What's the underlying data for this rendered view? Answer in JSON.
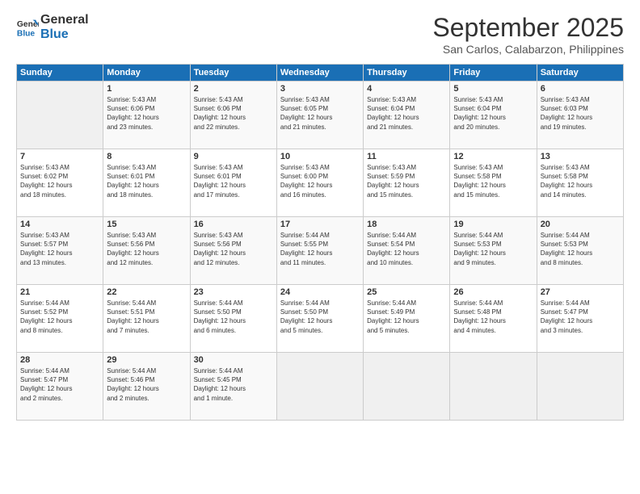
{
  "header": {
    "logo_line1": "General",
    "logo_line2": "Blue",
    "month": "September 2025",
    "location": "San Carlos, Calabarzon, Philippines"
  },
  "days_of_week": [
    "Sunday",
    "Monday",
    "Tuesday",
    "Wednesday",
    "Thursday",
    "Friday",
    "Saturday"
  ],
  "weeks": [
    [
      {
        "day": "",
        "info": ""
      },
      {
        "day": "1",
        "info": "Sunrise: 5:43 AM\nSunset: 6:06 PM\nDaylight: 12 hours\nand 23 minutes."
      },
      {
        "day": "2",
        "info": "Sunrise: 5:43 AM\nSunset: 6:06 PM\nDaylight: 12 hours\nand 22 minutes."
      },
      {
        "day": "3",
        "info": "Sunrise: 5:43 AM\nSunset: 6:05 PM\nDaylight: 12 hours\nand 21 minutes."
      },
      {
        "day": "4",
        "info": "Sunrise: 5:43 AM\nSunset: 6:04 PM\nDaylight: 12 hours\nand 21 minutes."
      },
      {
        "day": "5",
        "info": "Sunrise: 5:43 AM\nSunset: 6:04 PM\nDaylight: 12 hours\nand 20 minutes."
      },
      {
        "day": "6",
        "info": "Sunrise: 5:43 AM\nSunset: 6:03 PM\nDaylight: 12 hours\nand 19 minutes."
      }
    ],
    [
      {
        "day": "7",
        "info": "Sunrise: 5:43 AM\nSunset: 6:02 PM\nDaylight: 12 hours\nand 18 minutes."
      },
      {
        "day": "8",
        "info": "Sunrise: 5:43 AM\nSunset: 6:01 PM\nDaylight: 12 hours\nand 18 minutes."
      },
      {
        "day": "9",
        "info": "Sunrise: 5:43 AM\nSunset: 6:01 PM\nDaylight: 12 hours\nand 17 minutes."
      },
      {
        "day": "10",
        "info": "Sunrise: 5:43 AM\nSunset: 6:00 PM\nDaylight: 12 hours\nand 16 minutes."
      },
      {
        "day": "11",
        "info": "Sunrise: 5:43 AM\nSunset: 5:59 PM\nDaylight: 12 hours\nand 15 minutes."
      },
      {
        "day": "12",
        "info": "Sunrise: 5:43 AM\nSunset: 5:58 PM\nDaylight: 12 hours\nand 15 minutes."
      },
      {
        "day": "13",
        "info": "Sunrise: 5:43 AM\nSunset: 5:58 PM\nDaylight: 12 hours\nand 14 minutes."
      }
    ],
    [
      {
        "day": "14",
        "info": "Sunrise: 5:43 AM\nSunset: 5:57 PM\nDaylight: 12 hours\nand 13 minutes."
      },
      {
        "day": "15",
        "info": "Sunrise: 5:43 AM\nSunset: 5:56 PM\nDaylight: 12 hours\nand 12 minutes."
      },
      {
        "day": "16",
        "info": "Sunrise: 5:43 AM\nSunset: 5:56 PM\nDaylight: 12 hours\nand 12 minutes."
      },
      {
        "day": "17",
        "info": "Sunrise: 5:44 AM\nSunset: 5:55 PM\nDaylight: 12 hours\nand 11 minutes."
      },
      {
        "day": "18",
        "info": "Sunrise: 5:44 AM\nSunset: 5:54 PM\nDaylight: 12 hours\nand 10 minutes."
      },
      {
        "day": "19",
        "info": "Sunrise: 5:44 AM\nSunset: 5:53 PM\nDaylight: 12 hours\nand 9 minutes."
      },
      {
        "day": "20",
        "info": "Sunrise: 5:44 AM\nSunset: 5:53 PM\nDaylight: 12 hours\nand 8 minutes."
      }
    ],
    [
      {
        "day": "21",
        "info": "Sunrise: 5:44 AM\nSunset: 5:52 PM\nDaylight: 12 hours\nand 8 minutes."
      },
      {
        "day": "22",
        "info": "Sunrise: 5:44 AM\nSunset: 5:51 PM\nDaylight: 12 hours\nand 7 minutes."
      },
      {
        "day": "23",
        "info": "Sunrise: 5:44 AM\nSunset: 5:50 PM\nDaylight: 12 hours\nand 6 minutes."
      },
      {
        "day": "24",
        "info": "Sunrise: 5:44 AM\nSunset: 5:50 PM\nDaylight: 12 hours\nand 5 minutes."
      },
      {
        "day": "25",
        "info": "Sunrise: 5:44 AM\nSunset: 5:49 PM\nDaylight: 12 hours\nand 5 minutes."
      },
      {
        "day": "26",
        "info": "Sunrise: 5:44 AM\nSunset: 5:48 PM\nDaylight: 12 hours\nand 4 minutes."
      },
      {
        "day": "27",
        "info": "Sunrise: 5:44 AM\nSunset: 5:47 PM\nDaylight: 12 hours\nand 3 minutes."
      }
    ],
    [
      {
        "day": "28",
        "info": "Sunrise: 5:44 AM\nSunset: 5:47 PM\nDaylight: 12 hours\nand 2 minutes."
      },
      {
        "day": "29",
        "info": "Sunrise: 5:44 AM\nSunset: 5:46 PM\nDaylight: 12 hours\nand 2 minutes."
      },
      {
        "day": "30",
        "info": "Sunrise: 5:44 AM\nSunset: 5:45 PM\nDaylight: 12 hours\nand 1 minute."
      },
      {
        "day": "",
        "info": ""
      },
      {
        "day": "",
        "info": ""
      },
      {
        "day": "",
        "info": ""
      },
      {
        "day": "",
        "info": ""
      }
    ]
  ]
}
